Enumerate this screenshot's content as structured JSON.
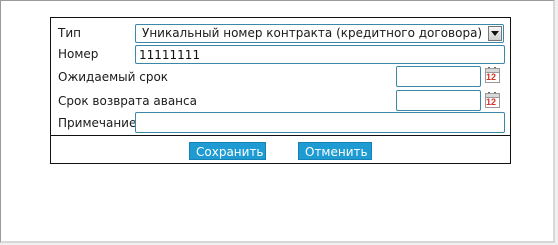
{
  "form": {
    "type_label": "Тип",
    "type_value": "Уникальный номер контракта (кредитного договора)",
    "number_label": "Номер",
    "number_value": "11111111",
    "expected_term_label": "Ожидаемый срок",
    "expected_term_value": "",
    "advance_return_label": "Срок возврата аванса",
    "advance_return_value": "",
    "note_label": "Примечание",
    "note_value": "",
    "calendar_day": "12"
  },
  "buttons": {
    "save_label": "Сохранить",
    "cancel_label": "Отменить"
  },
  "icons": {
    "dropdown": "chevron-down-icon",
    "calendar": "calendar-icon"
  },
  "colors": {
    "field_border": "#3a87a8",
    "button_bg": "#1e9bd2",
    "button_text": "#ffffff",
    "calendar_number": "#d4352a"
  }
}
